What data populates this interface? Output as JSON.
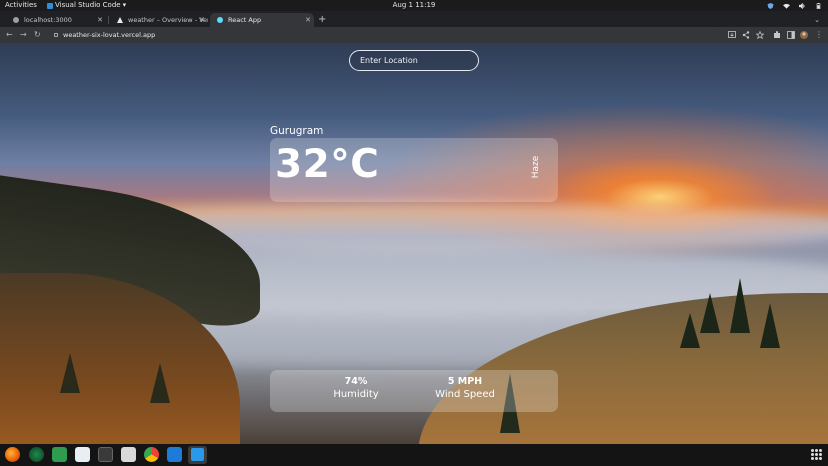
{
  "system": {
    "activities": "Activities",
    "active_app": "Visual Studio Code",
    "clock": "Aug 1  11:19"
  },
  "browser": {
    "tabs": [
      {
        "title": "localhost:3000"
      },
      {
        "title": "weather – Overview - Ver"
      },
      {
        "title": "React App"
      }
    ],
    "url": "weather-six-lovat.vercel.app"
  },
  "app": {
    "search": {
      "placeholder": "Enter Location"
    },
    "city": "Gurugram",
    "temperature": "32°C",
    "condition": "Haze",
    "humidity": {
      "value": "74%",
      "label": "Humidity"
    },
    "wind": {
      "value": "5 MPH",
      "label": "Wind Speed"
    }
  },
  "dock": {
    "apps": [
      "firefox-icon",
      "terminal-alt-icon",
      "spreadsheet-icon",
      "text-editor-icon",
      "terminal-icon",
      "files-icon",
      "chrome-icon",
      "vscode-icon",
      "vscode-insiders-icon"
    ]
  },
  "colors": {
    "card_bg": "rgba(255,255,255,0.22)",
    "text": "#ffffff"
  }
}
